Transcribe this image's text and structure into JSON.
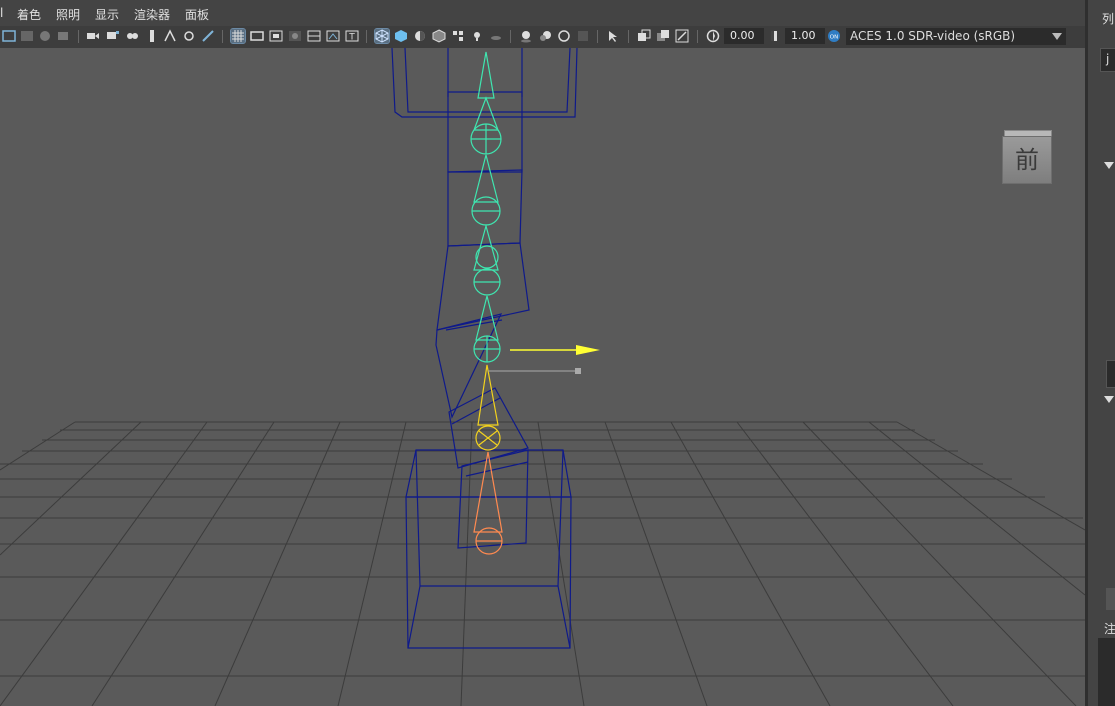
{
  "menu": {
    "first_partial": "l",
    "items": [
      "着色",
      "照明",
      "显示",
      "渲染器",
      "面板"
    ]
  },
  "toolbar": {
    "exposure_value": "0.00",
    "gamma_value": "1.00",
    "colorspace_badge": "ON",
    "colorspace_value": "ACES 1.0 SDR-video (sRGB)"
  },
  "viewcube": {
    "face_label": "前"
  },
  "side_panel": {
    "header_partial": "列",
    "field_partial": "j",
    "note_partial": "注"
  },
  "colors": {
    "viewport_bg": "#5a5a5a",
    "grid": "#3c3c3c",
    "control_blue": "#0f1a8a",
    "joint_cyan": "#3fe6b0",
    "joint_yellow": "#f2d21e",
    "joint_orange": "#ff8a50",
    "manipulator_yellow": "#ffff33"
  }
}
